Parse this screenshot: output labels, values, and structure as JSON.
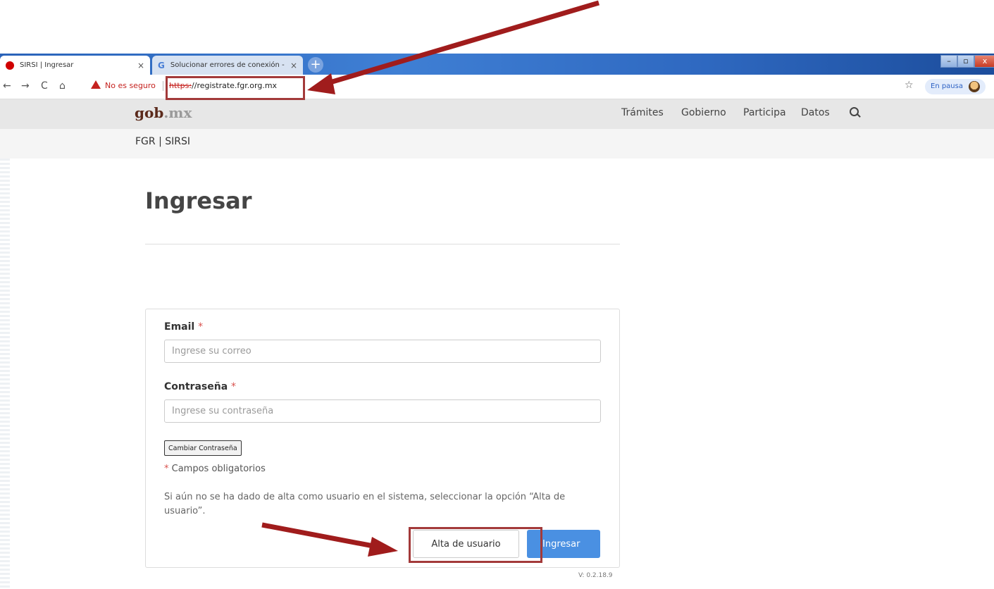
{
  "browser": {
    "tabs": [
      {
        "label": "SIRSI | Ingresar",
        "close": "×"
      },
      {
        "label": "Solucionar errores de conexión -",
        "close": "×"
      }
    ],
    "new_tab": "+",
    "window_controls": {
      "minimize": "–",
      "maximize": "▫",
      "close": "x"
    },
    "nav": {
      "back": "←",
      "forward": "→",
      "reload": "C",
      "home": "⌂"
    },
    "security_warning": "No es seguro",
    "url_protocol": "https:",
    "url_rest": "//registrate.fgr.org.mx",
    "bookmark": "☆",
    "profile_status": "En pausa"
  },
  "gob_header": {
    "logo_main": "gob",
    "logo_suffix": ".mx",
    "nav_items": [
      "Trámites",
      "Gobierno",
      "Participa",
      "Datos"
    ],
    "subtitle": "FGR | SIRSI"
  },
  "page": {
    "title": "Ingresar"
  },
  "form": {
    "email_label": "Email",
    "email_placeholder": "Ingrese su correo",
    "password_label": "Contraseña",
    "password_placeholder": "Ingrese su contraseña",
    "required_mark": "*",
    "change_password_label": "Cambiar Contraseña",
    "required_note": "Campos obligatorios",
    "info_text": "Si aún no se ha dado de alta como usuario en el sistema, seleccionar la opción “Alta de usuario”.",
    "signup_label": "Alta de usuario",
    "login_label": "Ingresar"
  },
  "version": "V: 0.2.18.9",
  "colors": {
    "annotation": "#a01c1c",
    "primary_button": "#4a90e2",
    "required": "#d9534f"
  }
}
